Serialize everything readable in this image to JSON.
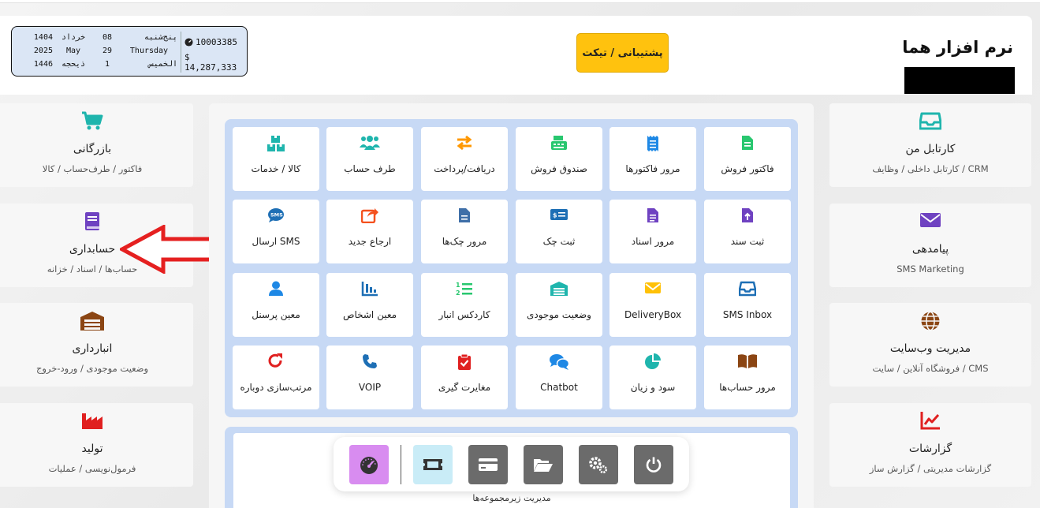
{
  "header": {
    "brand": "نرم افزار هما",
    "support_label": "پشتیبانی / تیکت"
  },
  "datebox": {
    "balance_account": "10003385",
    "balance_money": "$ 14,287,333",
    "rows": [
      {
        "year": "1404",
        "month": "خرداد",
        "day": "08",
        "weekday": "پنج‌شنبه"
      },
      {
        "year": "2025",
        "month": "May",
        "day": "29",
        "weekday": "Thursday"
      },
      {
        "year": "1446",
        "month": "ذیحجه",
        "day": "1",
        "weekday": "الخميس"
      }
    ]
  },
  "left_cards": [
    {
      "title": "بازرگانی",
      "subtitle": "فاکتور / طرف‌حساب / کالا",
      "icon": "cart-icon",
      "color": "#1fb5ad"
    },
    {
      "title": "حسابداری",
      "subtitle": "حساب‌ها / اسناد / خزانه",
      "icon": "book-icon",
      "color": "#6f42c1"
    },
    {
      "title": "انبارداری",
      "subtitle": "وضعیت موجودی / ورود-خروج",
      "icon": "warehouse-icon",
      "color": "#8b4513"
    },
    {
      "title": "تولید",
      "subtitle": "فرمول‌نویسی / عملیات",
      "icon": "factory-icon",
      "color": "#e02020"
    }
  ],
  "right_cards": [
    {
      "title": "کارتابل من",
      "subtitle": "کارتابل داخلی / وظایف / CRM",
      "icon": "inbox-icon",
      "color": "#1fb5ad"
    },
    {
      "title": "پیامدهی",
      "subtitle": "SMS Marketing",
      "icon": "envelope-icon",
      "color": "#6f42c1"
    },
    {
      "title": "مدیریت وب‌سایت",
      "subtitle": "فروشگاه آنلاین / سایت / CMS",
      "icon": "globe-icon",
      "color": "#8b4513"
    },
    {
      "title": "گزارشات",
      "subtitle": "گزارشات مدیریتی / گزارش ساز",
      "icon": "chart-line-icon",
      "color": "#e02020"
    }
  ],
  "tiles": [
    [
      {
        "label": "فاکتور فروش",
        "icon": "invoice-icon",
        "color": "#28c76f"
      },
      {
        "label": "مرور فاکتورها",
        "icon": "receipt-icon",
        "color": "#1e88e5"
      },
      {
        "label": "صندوق فروش",
        "icon": "cash-register-icon",
        "color": "#28c76f"
      },
      {
        "label": "دریافت/پرداخت",
        "icon": "exchange-icon",
        "color": "#ff9800"
      },
      {
        "label": "طرف حساب",
        "icon": "users-icon",
        "color": "#1fb5ad"
      },
      {
        "label": "کالا / خدمات",
        "icon": "boxes-icon",
        "color": "#1fb5ad"
      }
    ],
    [
      {
        "label": "ثبت سند",
        "icon": "file-upload-icon",
        "color": "#6f42c1"
      },
      {
        "label": "مرور اسناد",
        "icon": "file-text-icon",
        "color": "#6f42c1"
      },
      {
        "label": "ثبت چک",
        "icon": "money-check-icon",
        "color": "#1e6fb5"
      },
      {
        "label": "مرور چک‌ها",
        "icon": "file-icon",
        "color": "#1e6fb5"
      },
      {
        "label": "ارجاع جدید",
        "icon": "share-icon",
        "color": "#f4511e"
      },
      {
        "label": "ارسال SMS",
        "icon": "sms-icon",
        "color": "#1e6fb5"
      }
    ],
    [
      {
        "label": "SMS Inbox",
        "icon": "inbox-icon",
        "color": "#1e6fb5"
      },
      {
        "label": "DeliveryBox",
        "icon": "envelope-icon",
        "color": "#ffc107"
      },
      {
        "label": "وضعیت موجودی",
        "icon": "warehouse-icon",
        "color": "#1fb5ad"
      },
      {
        "label": "کاردکس انبار",
        "icon": "list-ol-icon",
        "color": "#28c76f"
      },
      {
        "label": "معین اشخاص",
        "icon": "bar-chart-icon",
        "color": "#1e6fb5"
      },
      {
        "label": "معین پرسنل",
        "icon": "user-icon",
        "color": "#1e88e5"
      }
    ],
    [
      {
        "label": "مرور حساب‌ها",
        "icon": "open-book-icon",
        "color": "#8b4513"
      },
      {
        "label": "سود و زیان",
        "icon": "pie-chart-icon",
        "color": "#1fb5ad"
      },
      {
        "label": "Chatbot",
        "icon": "comments-icon",
        "color": "#1e88e5"
      },
      {
        "label": "مغایرت گیری",
        "icon": "clipboard-check-icon",
        "color": "#e02020"
      },
      {
        "label": "VOIP",
        "icon": "phone-icon",
        "color": "#1e6fb5"
      },
      {
        "label": "مرتب‌سازی دوباره",
        "icon": "redo-icon",
        "color": "#e02020"
      }
    ]
  ],
  "submenu_label": "مدیریت زیرمجموعه‌ها",
  "dock": [
    {
      "icon": "power-icon",
      "color": "#6b6b6b"
    },
    {
      "icon": "cogs-icon",
      "color": "#6b6b6b"
    },
    {
      "icon": "folder-open-icon",
      "color": "#6b6b6b"
    },
    {
      "icon": "credit-card-icon",
      "color": "#6b6b6b"
    },
    {
      "icon": "ticket-icon",
      "color": "#c9ecf7"
    },
    {
      "icon": "dashboard-icon",
      "color": "#d88cf0"
    }
  ],
  "accent": "#c7d9f5"
}
